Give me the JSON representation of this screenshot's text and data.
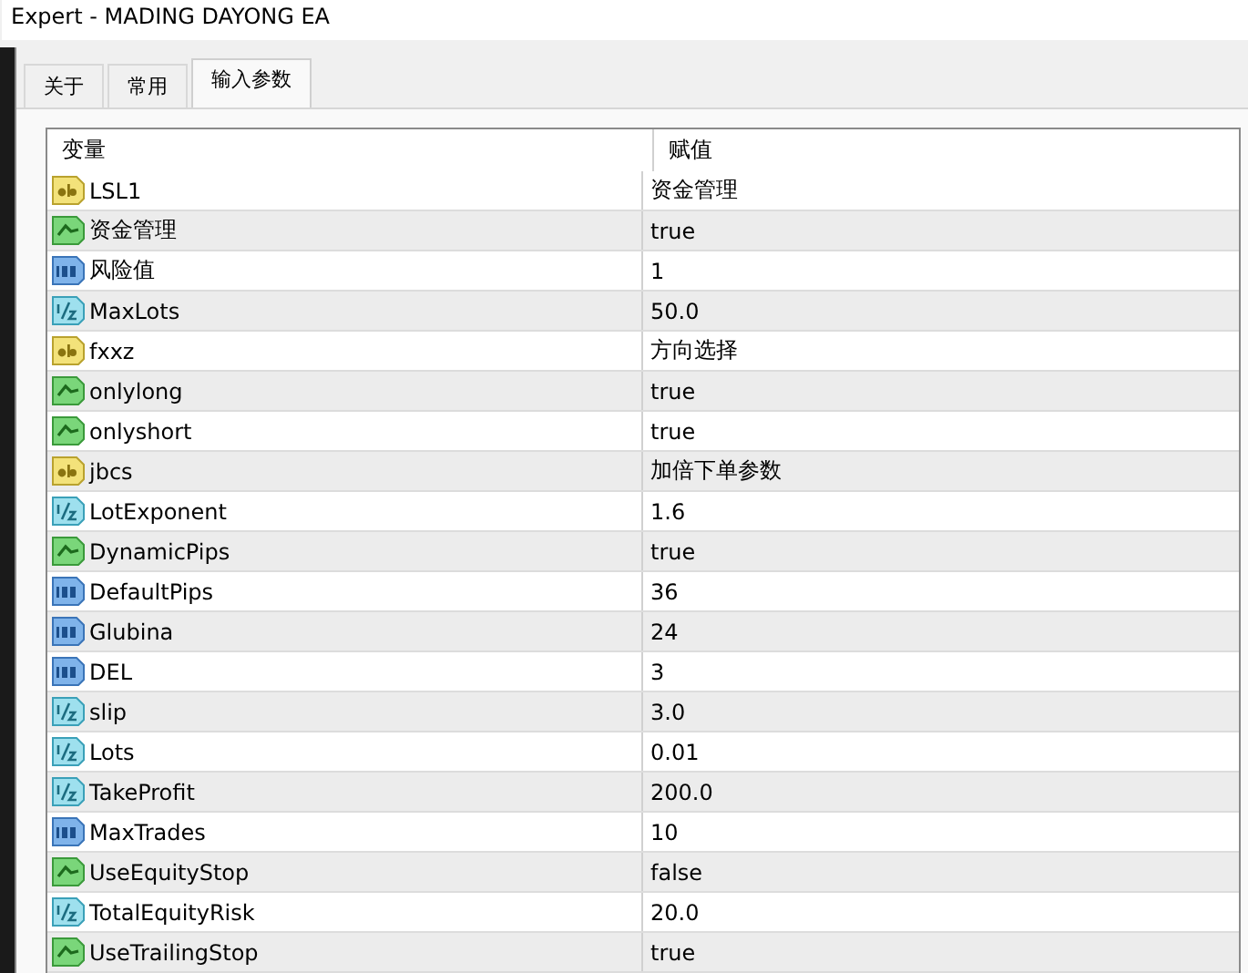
{
  "window": {
    "title": "Expert - MADING DAYONG EA"
  },
  "tabs": [
    {
      "label": "关于",
      "selected": false
    },
    {
      "label": "常用",
      "selected": false
    },
    {
      "label": "输入参数",
      "selected": true
    }
  ],
  "table": {
    "columns": [
      "变量",
      "赋值"
    ],
    "rows": [
      {
        "kind": "string",
        "name": "LSL1",
        "value": "资金管理"
      },
      {
        "kind": "bool",
        "name": "资金管理",
        "value": "true"
      },
      {
        "kind": "int",
        "name": "风险值",
        "value": "1"
      },
      {
        "kind": "double",
        "name": "MaxLots",
        "value": "50.0"
      },
      {
        "kind": "string",
        "name": "fxxz",
        "value": "方向选择"
      },
      {
        "kind": "bool",
        "name": "onlylong",
        "value": "true"
      },
      {
        "kind": "bool",
        "name": "onlyshort",
        "value": "true"
      },
      {
        "kind": "string",
        "name": "jbcs",
        "value": "加倍下单参数"
      },
      {
        "kind": "double",
        "name": "LotExponent",
        "value": "1.6"
      },
      {
        "kind": "bool",
        "name": "DynamicPips",
        "value": "true"
      },
      {
        "kind": "int",
        "name": "DefaultPips",
        "value": "36"
      },
      {
        "kind": "int",
        "name": "Glubina",
        "value": "24"
      },
      {
        "kind": "int",
        "name": "DEL",
        "value": "3"
      },
      {
        "kind": "double",
        "name": "slip",
        "value": "3.0"
      },
      {
        "kind": "double",
        "name": "Lots",
        "value": "0.01"
      },
      {
        "kind": "double",
        "name": "TakeProfit",
        "value": "200.0"
      },
      {
        "kind": "int",
        "name": "MaxTrades",
        "value": "10"
      },
      {
        "kind": "bool",
        "name": "UseEquityStop",
        "value": "false"
      },
      {
        "kind": "double",
        "name": "TotalEquityRisk",
        "value": "20.0"
      },
      {
        "kind": "bool",
        "name": "UseTrailingStop",
        "value": "true"
      }
    ]
  }
}
